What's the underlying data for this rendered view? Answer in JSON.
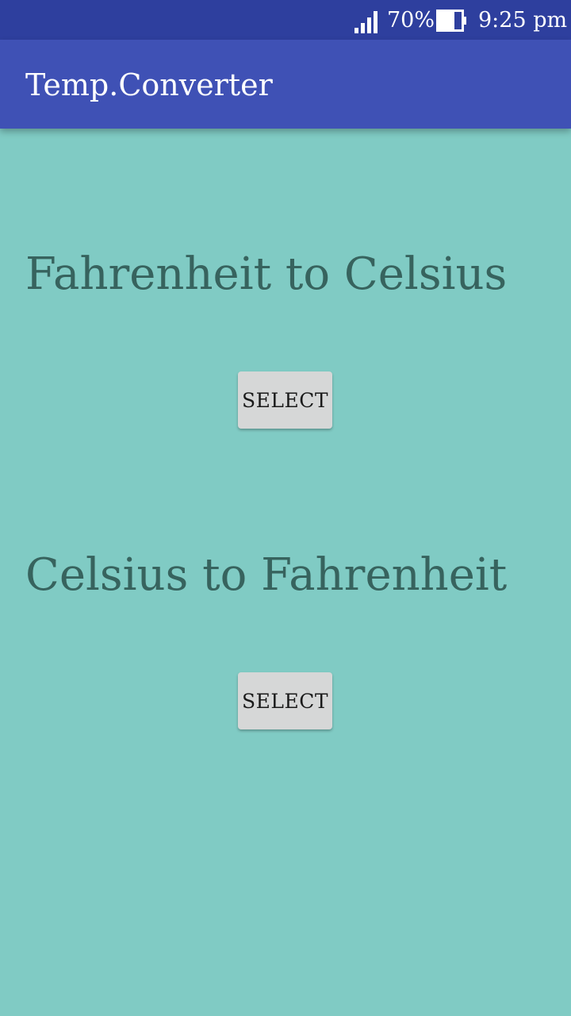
{
  "status_bar": {
    "signal_icon": "signal-bars-icon",
    "battery_percent": "70%",
    "battery_icon": "battery-icon",
    "time": "9:25 pm"
  },
  "app_bar": {
    "title": "Temp.Converter"
  },
  "sections": [
    {
      "title": "Fahrenheit to Celsius",
      "button_label": "SELECT"
    },
    {
      "title": "Celsius to Fahrenheit",
      "button_label": "SELECT"
    }
  ],
  "colors": {
    "status_bar": "#2e3f9e",
    "app_bar": "#3f51b5",
    "background": "#80cbc4",
    "heading_text": "#37635e",
    "button": "#d6d7d7"
  }
}
